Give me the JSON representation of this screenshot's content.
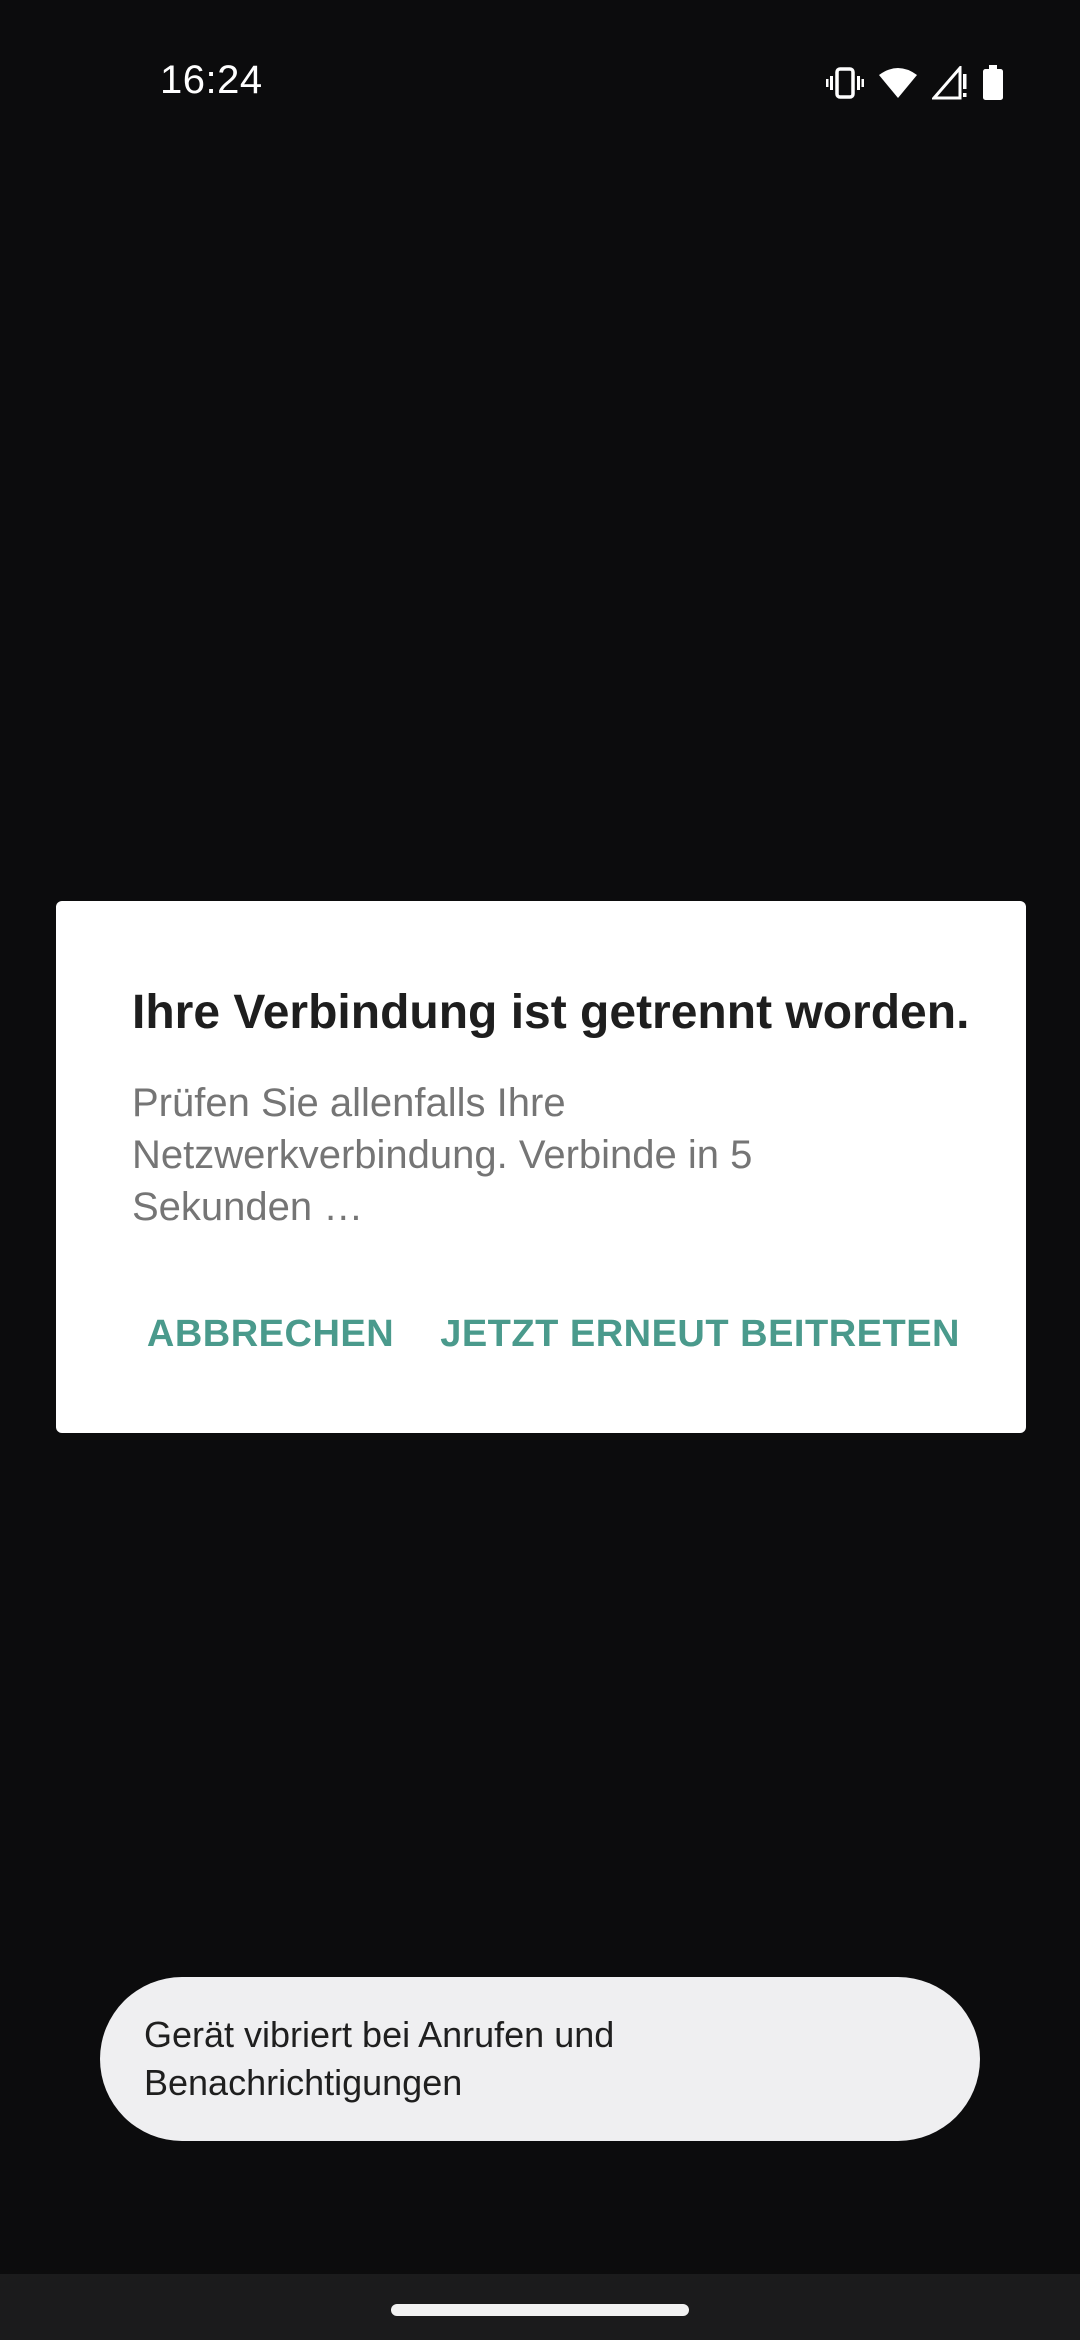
{
  "status_bar": {
    "time": "16:24",
    "icons": [
      "vibrate-icon",
      "wifi-icon",
      "cell-signal-icon",
      "battery-icon"
    ]
  },
  "dialog": {
    "title": "Ihre Verbindung ist getrennt worden.",
    "message": "Prüfen Sie allenfalls Ihre Netzwerkverbindung. Verbinde in 5 Sekunden …",
    "cancel_label": "ABBRECHEN",
    "rejoin_label": "JETZT ERNEUT BEITRETEN"
  },
  "toast": {
    "text": "Gerät vibriert bei Anrufen und Benachrichtigungen"
  },
  "colors": {
    "background": "#0c0c0d",
    "dialog_bg": "#ffffff",
    "accent": "#4a9a8c",
    "toast_bg": "#efeff1"
  }
}
